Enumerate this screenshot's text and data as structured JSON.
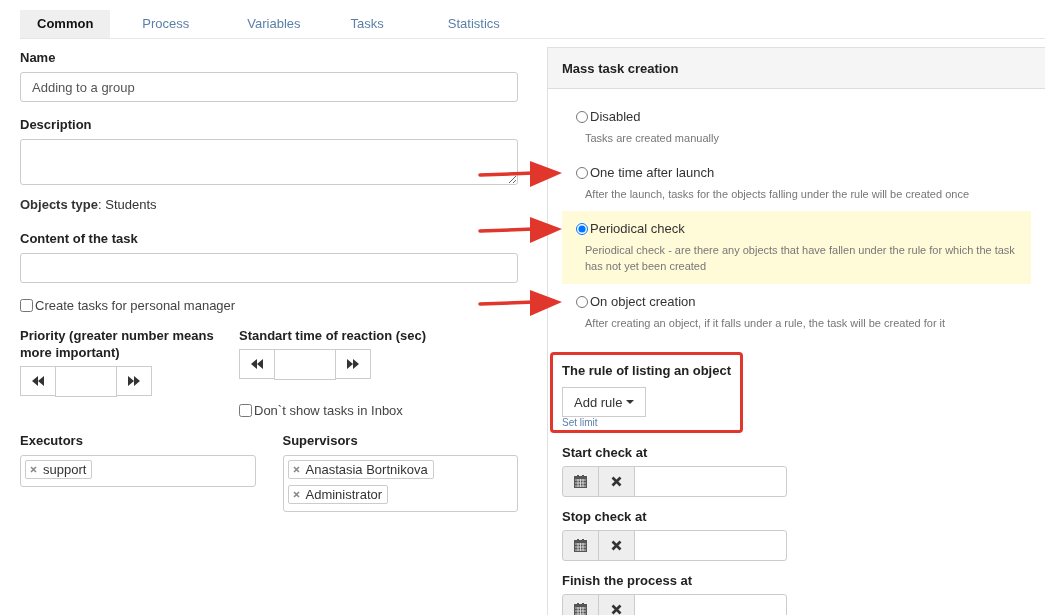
{
  "tabs": [
    {
      "label": "Common",
      "selected": true
    },
    {
      "label": "Process",
      "selected": false
    },
    {
      "label": "Variables",
      "selected": false
    },
    {
      "label": "Tasks",
      "selected": false
    },
    {
      "label": "Statistics",
      "selected": false
    }
  ],
  "name": {
    "label": "Name",
    "value": "Adding to a group"
  },
  "description": {
    "label": "Description"
  },
  "objects_type": {
    "text": "**Objects type**: Students"
  },
  "content": {
    "label": "Content of the task"
  },
  "personal_manager": {
    "label": "Create tasks for personal manager",
    "checked": false
  },
  "priority": {
    "label": "Priority (greater number means more important)"
  },
  "reaction_time": {
    "label": "Standart time of reaction (sec)"
  },
  "hide_inbox": {
    "label": "Don`t show tasks in Inbox",
    "checked": false
  },
  "executors": {
    "label": "Executors",
    "tags": [
      "support"
    ]
  },
  "supervisors": {
    "label": "Supervisors",
    "tags": [
      "Anastasia Bortnikova",
      "Administrator"
    ]
  },
  "panel": {
    "title": "Mass task creation",
    "modes": [
      {
        "label": "Disabled",
        "description": "Tasks are created manually",
        "selected": false,
        "arrow": false
      },
      {
        "label": "One time after launch",
        "description": "After the launch, tasks for the objects falling under the rule will be created once",
        "selected": false,
        "arrow": true
      },
      {
        "label": "Periodical check",
        "description": "Periodical check - are there any objects that have fallen under the rule for which the task has not yet been created",
        "selected": true,
        "arrow": true
      },
      {
        "label": "On object creation",
        "description": "After creating an object, if it falls under a rule, the task will be created for it",
        "selected": false,
        "arrow": true
      }
    ],
    "rule": {
      "label": "The rule of listing an object",
      "button": "Add rule",
      "link": "Set limit"
    },
    "dates": [
      {
        "label": "Start check at"
      },
      {
        "label": "Stop check at"
      },
      {
        "label": "Finish the process at"
      }
    ]
  }
}
